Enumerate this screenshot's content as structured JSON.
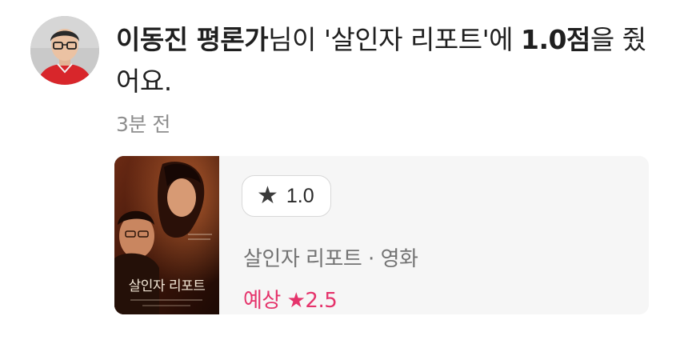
{
  "activity": {
    "user_name": "이동진 평론가",
    "text_after_name": "님이 '",
    "movie_title": "살인자 리포트",
    "text_after_title": "'에 ",
    "score": "1.0점",
    "text_after_score": "을 줬어요.",
    "time_ago": "3분 전"
  },
  "card": {
    "poster_title": "살인자 리포트",
    "rating_icon": "star-icon",
    "rating_value": "1.0",
    "movie_meta": "살인자 리포트 · 영화",
    "expected_label": "예상 ★2.5"
  },
  "colors": {
    "expected": "#e5336b",
    "card_bg": "#f6f6f6",
    "timestamp": "#8e8e8e"
  }
}
